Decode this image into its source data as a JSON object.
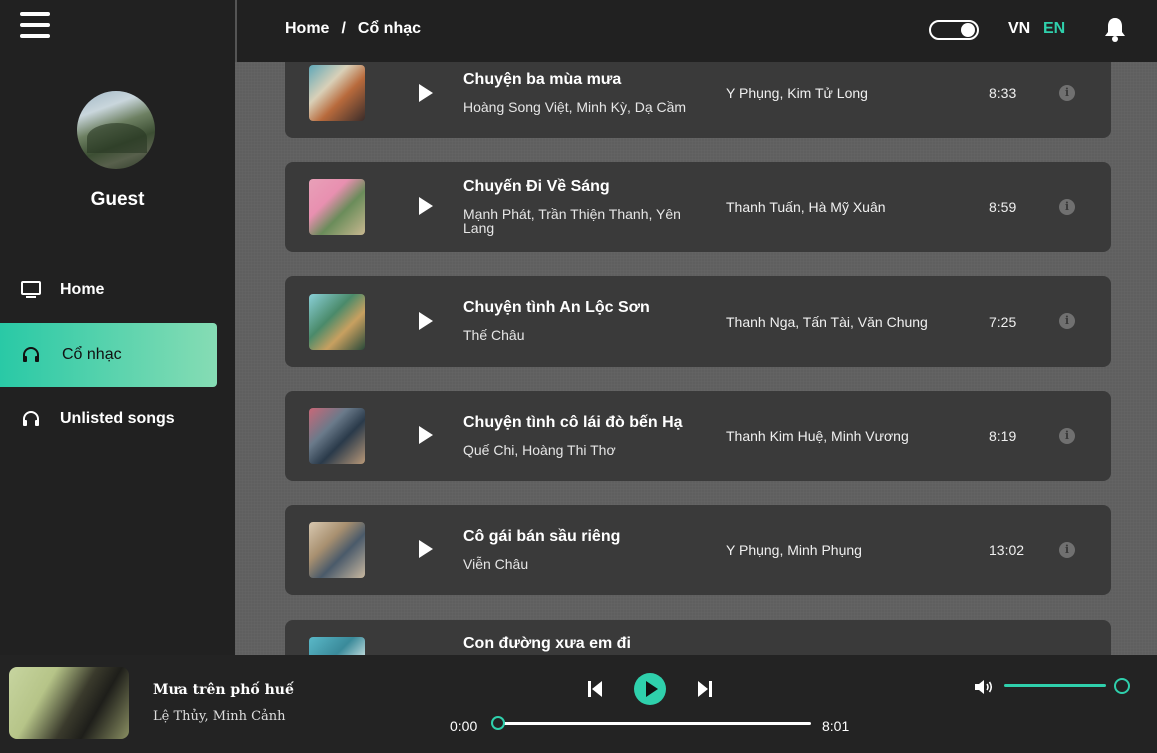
{
  "header": {
    "breadcrumb_home": "Home",
    "breadcrumb_sep": "/",
    "breadcrumb_current": "Cổ nhạc",
    "lang_vn": "VN",
    "lang_en": "EN",
    "active_lang_color": "#2fd0ac"
  },
  "sidebar": {
    "username": "Guest",
    "items": [
      {
        "label": "Home",
        "icon": "monitor-icon"
      },
      {
        "label": "Cổ nhạc",
        "icon": "headphones-icon",
        "active": true
      },
      {
        "label": "Unlisted songs",
        "icon": "headphones-icon"
      }
    ]
  },
  "songs": [
    {
      "title": "Chuyện ba mùa mưa",
      "composer": "Hoàng Song Việt, Minh Kỳ, Dạ Cầm",
      "singer": "Y Phụng, Kim Tử Long",
      "duration": "8:33"
    },
    {
      "title": "Chuyến Đi Về Sáng",
      "composer": "Mạnh Phát, Trần Thiện Thanh, Yên Lang",
      "singer": "Thanh Tuấn, Hà Mỹ Xuân",
      "duration": "8:59"
    },
    {
      "title": "Chuyện tình An Lộc Sơn",
      "composer": "Thế Châu",
      "singer": "Thanh Nga, Tấn Tài, Văn Chung",
      "duration": "7:25"
    },
    {
      "title": "Chuyện tình cô lái đò bến Hạ",
      "composer": "Quế Chi, Hoàng Thi Thơ",
      "singer": "Thanh Kim Huệ, Minh Vương",
      "duration": "8:19"
    },
    {
      "title": "Cô gái bán sầu riêng",
      "composer": "Viễn Châu",
      "singer": "Y Phụng, Minh Phụng",
      "duration": "13:02"
    },
    {
      "title": "Con đường xưa em đi",
      "composer": "",
      "singer": "",
      "duration": ""
    }
  ],
  "player": {
    "title": "Mưa trên phố huế",
    "artist": "Lệ Thủy, Minh Cảnh",
    "current_time": "0:00",
    "total_time": "8:01",
    "progress": 0,
    "volume": 0.85,
    "accent_color": "#2fd0ac"
  }
}
